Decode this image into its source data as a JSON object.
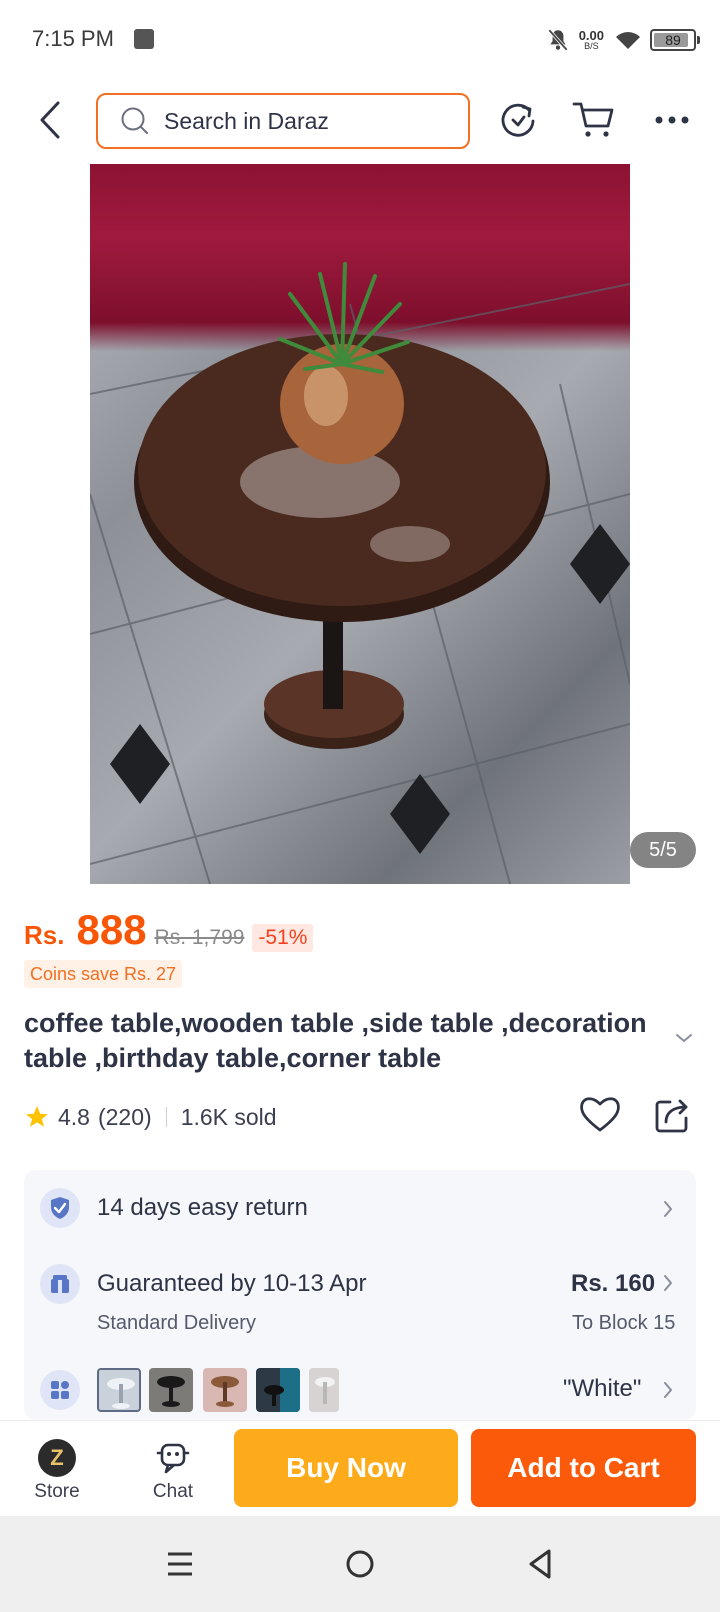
{
  "status_bar": {
    "time": "7:15 PM",
    "net_speed_value": "0.00",
    "net_speed_unit": "B/S",
    "battery": "89",
    "icons": [
      "notification-muted-icon",
      "wifi-icon",
      "battery-icon"
    ]
  },
  "header": {
    "search_placeholder": "Search in Daraz",
    "icons": [
      "back-icon",
      "search-icon",
      "refresh-icon",
      "cart-icon",
      "more-icon"
    ]
  },
  "gallery": {
    "counter": "5/5"
  },
  "product": {
    "currency": "Rs.",
    "price": "888",
    "original_price": "Rs. 1,799",
    "discount": "-51%",
    "coins": "Coins save Rs. 27",
    "title": "coffee table,wooden table ,side table ,decoration table ,birthday table,corner table",
    "rating": "4.8",
    "rating_count": "(220)",
    "sold": "1.6K sold"
  },
  "info": {
    "return_label": "14 days easy return",
    "delivery_label": "Guaranteed by 10-13 Apr",
    "delivery_type": "Standard Delivery",
    "delivery_fee": "Rs. 160",
    "delivery_location": "To Block 15",
    "variant_selected": "\"White\""
  },
  "action_bar": {
    "store_label": "Store",
    "chat_label": "Chat",
    "buy_now": "Buy Now",
    "add_to_cart": "Add to Cart"
  },
  "colors": {
    "accent": "#f85606",
    "buy_now": "#fdab1a",
    "add_to_cart": "#fa5a0a"
  }
}
